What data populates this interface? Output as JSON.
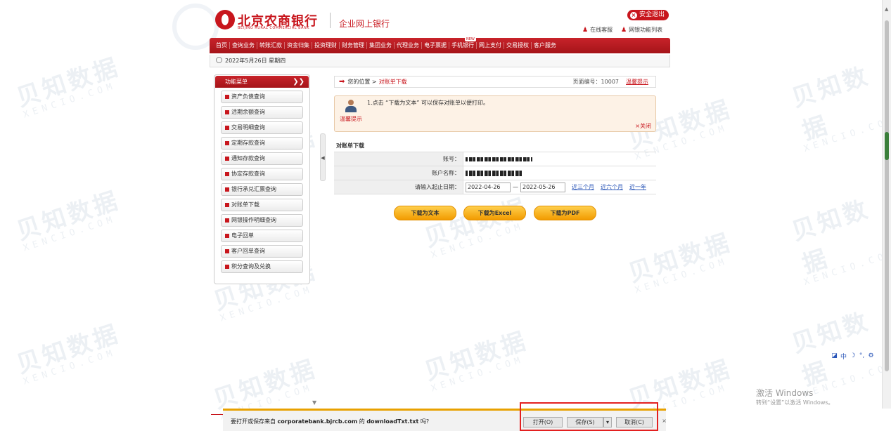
{
  "header": {
    "bank_name_cn": "北京农商银行",
    "bank_name_en": "BEIJING RURAL COMMERCIAL BANK",
    "subtitle": "企业网上银行",
    "logout": "安全退出",
    "online_service": "在线客服",
    "network_points": "网银功能列表"
  },
  "nav": {
    "items": [
      "首页",
      "查询业务",
      "转账汇款",
      "资金归集",
      "投资理财",
      "财务管理",
      "集团业务",
      "代理业务",
      "电子票据",
      "手机银行",
      "网上支付",
      "交易授权",
      "客户服务"
    ],
    "badge": "NEW"
  },
  "date_bar": {
    "date": "2022年5月26日 星期四"
  },
  "sidebar": {
    "title": "功能菜单",
    "chevron": "❯❯",
    "items": [
      "资产负债查询",
      "活期余额查询",
      "交易明细查询",
      "定期存款查询",
      "通知存款查询",
      "协定存款查询",
      "银行承兑汇票查询",
      "对账单下载",
      "网银操作明细查询",
      "电子回单",
      "客户回单查询",
      "积分查询及兑换"
    ]
  },
  "breadcrumb": {
    "prefix": "您的位置 >",
    "current": "对账单下载",
    "page_no": "页面编号：10007",
    "tip": "温馨提示"
  },
  "notice": {
    "label": "温馨提示",
    "message": "1.点击 “下载为文本” 可以保存对账单以便打印。",
    "close": "×关闭"
  },
  "form": {
    "title": "对账单下载",
    "account_label": "账号：",
    "account_name_label": "账户名称：",
    "date_label": "请输入起止日期：",
    "start_date": "2022-04-26",
    "dash": "—",
    "end_date": "2022-05-26",
    "quick": [
      "近三个月",
      "近六个月",
      "近一年"
    ]
  },
  "buttons": {
    "text": "下载为文本",
    "excel": "下载为Excel",
    "pdf": "下载为PDF"
  },
  "download_bar": {
    "question_prefix": "要打开或保存来自",
    "domain": "corporatebank.bjrcb.com",
    "question_mid": "的",
    "file": "downloadTxt.txt",
    "question_suffix": "吗?",
    "open": "打开(O)",
    "save": "保存(S)",
    "cancel": "取消(C)",
    "close": "×"
  },
  "ime": [
    "中",
    "☽",
    "°,",
    "⚙"
  ],
  "windows": {
    "activate": "激活 Windows",
    "activate_hint": "转到“设置”以激活 Windows。"
  },
  "watermark": {
    "cn": "贝知数据",
    "en": "XENCIO.COM"
  },
  "colors": {
    "brand_red": "#c8161d",
    "button_orange": "#f29b00",
    "highlight_box": "#e32020"
  }
}
